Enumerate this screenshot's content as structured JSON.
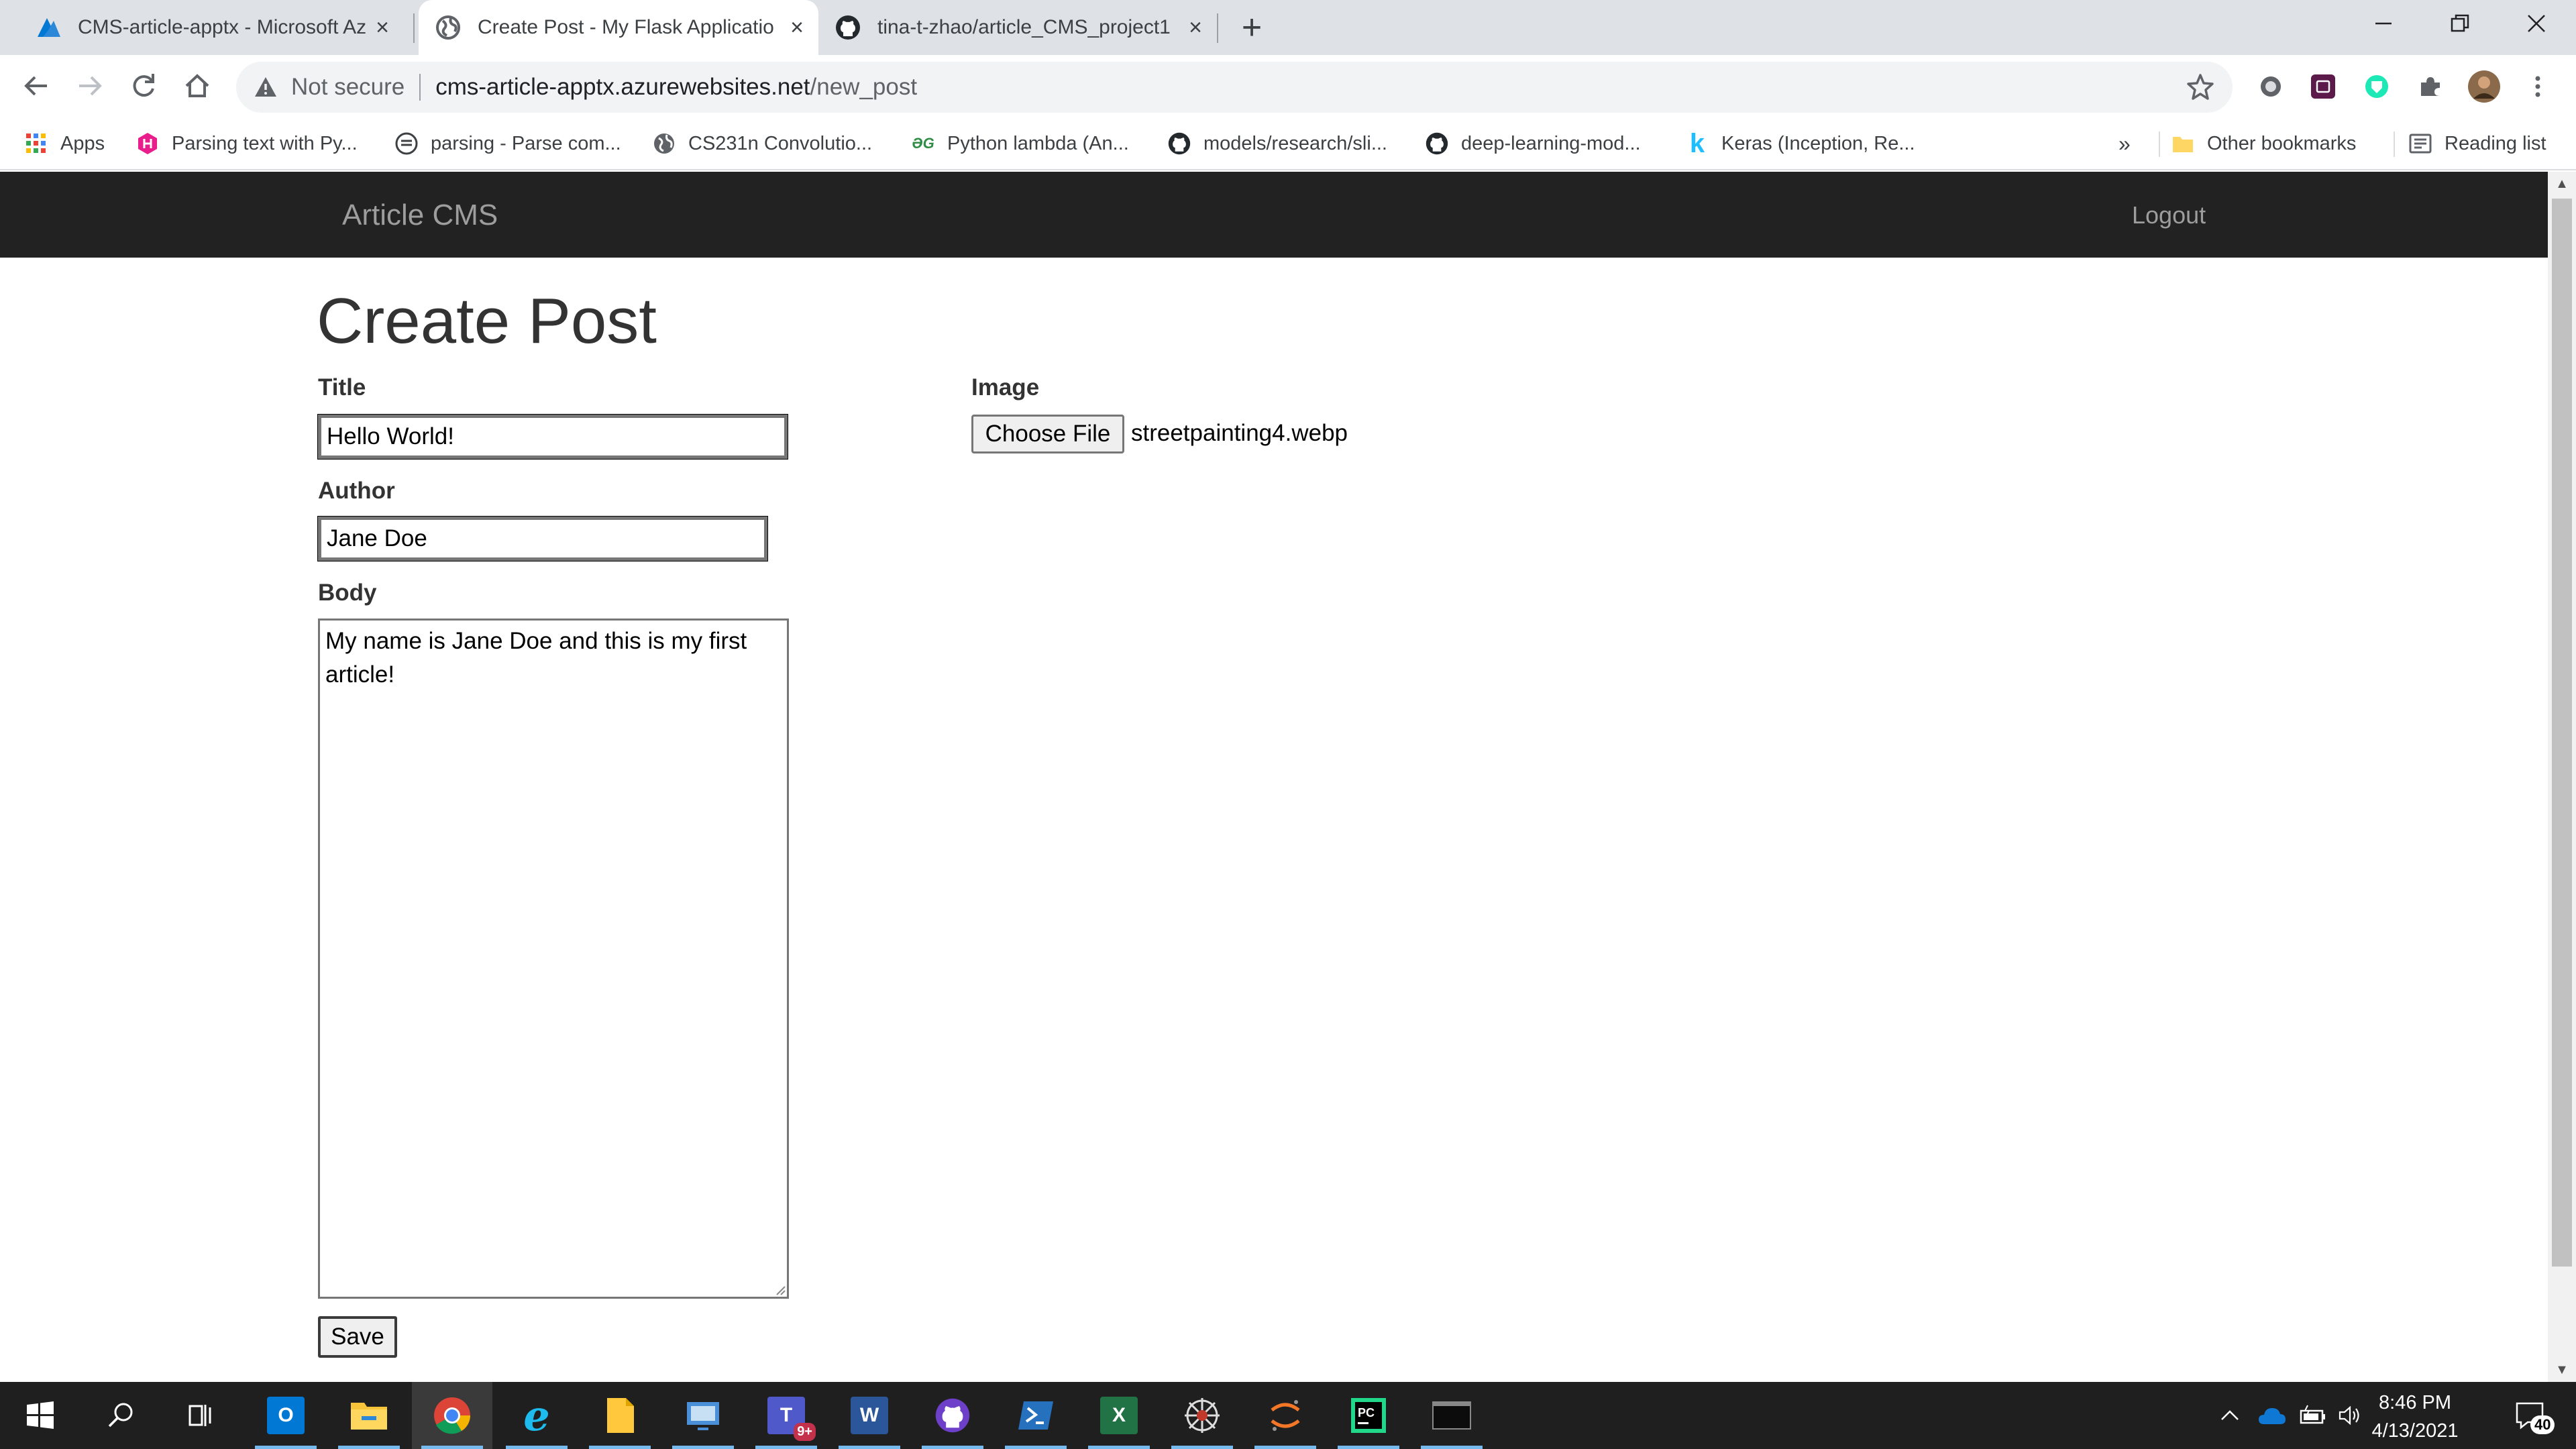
{
  "browser": {
    "tabs": [
      {
        "title": "CMS-article-apptx - Microsoft Az",
        "icon": "azure-icon"
      },
      {
        "title": "Create Post - My Flask Applicatio",
        "icon": "globe-icon"
      },
      {
        "title": "tina-t-zhao/article_CMS_project1",
        "icon": "github-icon"
      }
    ],
    "new_tab": "+",
    "security_label": "Not secure",
    "url_host": "cms-article-apptx.azurewebsites.net",
    "url_path": "/new_post",
    "bookmarks": [
      {
        "label": "Apps",
        "icon": "apps-grid-icon"
      },
      {
        "label": "Parsing text with Py...",
        "icon": "hackernoon-icon"
      },
      {
        "label": "parsing - Parse com...",
        "icon": "stackexchange-icon"
      },
      {
        "label": "CS231n Convolutio...",
        "icon": "globe-icon"
      },
      {
        "label": "Python lambda (An...",
        "icon": "geeksforgeeks-icon"
      },
      {
        "label": "models/research/sli...",
        "icon": "github-icon"
      },
      {
        "label": "deep-learning-mod...",
        "icon": "github-icon"
      },
      {
        "label": "Keras (Inception, Re...",
        "icon": "kaggle-icon"
      }
    ],
    "bookmarks_overflow": "»",
    "other_bookmarks": "Other bookmarks",
    "reading_list": "Reading list"
  },
  "page": {
    "brand": "Article CMS",
    "logout": "Logout",
    "heading": "Create Post",
    "form": {
      "title_label": "Title",
      "title_value": "Hello World!",
      "author_label": "Author",
      "author_value": "Jane Doe",
      "body_label": "Body",
      "body_value": "My name is Jane Doe and this is my first article!",
      "image_label": "Image",
      "choose_file": "Choose File",
      "file_name": "streetpainting4.webp",
      "save": "Save"
    }
  },
  "taskbar": {
    "apps": [
      "start-icon",
      "search-icon",
      "task-view-icon",
      "outlook-icon",
      "file-explorer-icon",
      "chrome-icon",
      "internet-explorer-icon",
      "sticky-folder-icon",
      "remote-desktop-icon",
      "teams-icon",
      "word-icon",
      "github-desktop-icon",
      "powershell-icon",
      "excel-icon",
      "spider-app-icon",
      "jupyter-icon",
      "pycharm-icon",
      "terminal-icon"
    ],
    "teams_badge": "9+",
    "time": "8:46 PM",
    "date": "4/13/2021",
    "notifications": "40"
  },
  "colors": {
    "navbar_bg": "#222222",
    "navbar_text": "#9d9d9d",
    "tabstrip_bg": "#dee1e6",
    "taskbar_bg": "#1f1f1f"
  }
}
